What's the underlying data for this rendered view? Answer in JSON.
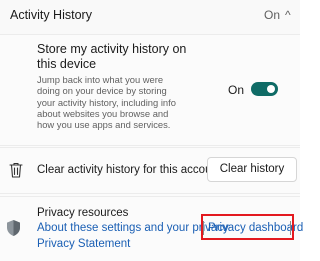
{
  "activity_history": {
    "title": "Activity History",
    "state": "On",
    "chevron": "^"
  },
  "store_setting": {
    "title": "Store my activity history on this device",
    "description": "Jump back into what you were doing on your device by storing your activity history, including info about websites you browse and how you use apps and services.",
    "toggle_state": "On",
    "toggle_on": true
  },
  "clear_history": {
    "label": "Clear activity history for this account",
    "button": "Clear history",
    "icon": "trash-icon"
  },
  "privacy_resources": {
    "heading": "Privacy resources",
    "links": {
      "about": "About these settings and your privacy",
      "dashboard": "Privacy dashboard",
      "statement": "Privacy Statement"
    },
    "icon": "shield-icon"
  },
  "colors": {
    "accent": "#0f6b66",
    "link": "#1a5fb4",
    "highlight": "#e3191f"
  }
}
